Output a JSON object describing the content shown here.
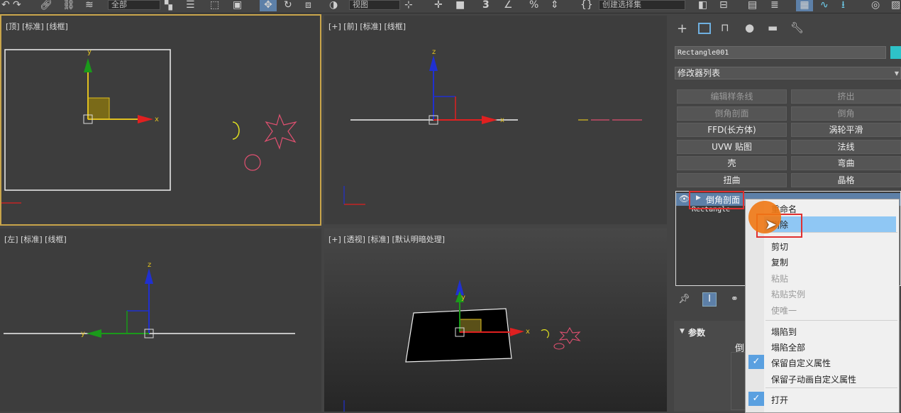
{
  "toolbar": {
    "filter_dropdown": "全部",
    "view_dropdown": "视图",
    "selection_set": "创建选择集",
    "toggle_3": "3",
    "percent": "%"
  },
  "viewports": {
    "top": "[顶] [标准] [线框]",
    "front": "[+] [前] [标准] [线框]",
    "left": "[左] [标准] [线框]",
    "persp": "[+] [透视] [标准] [默认明暗处理]"
  },
  "axis": {
    "x": "x",
    "y": "y",
    "z": "z"
  },
  "panel": {
    "object_name": "Rectangle001",
    "modifier_list": "修改器列表",
    "buttons": [
      {
        "label": "编辑样条线",
        "enabled": false
      },
      {
        "label": "挤出",
        "enabled": false
      },
      {
        "label": "倒角剖面",
        "enabled": false
      },
      {
        "label": "倒角",
        "enabled": false
      },
      {
        "label": "FFD(长方体)",
        "enabled": true
      },
      {
        "label": "涡轮平滑",
        "enabled": true
      },
      {
        "label": "UVW 贴图",
        "enabled": true
      },
      {
        "label": "法线",
        "enabled": true
      },
      {
        "label": "壳",
        "enabled": true
      },
      {
        "label": "弯曲",
        "enabled": true
      },
      {
        "label": "扭曲",
        "enabled": true
      },
      {
        "label": "晶格",
        "enabled": true
      }
    ],
    "stack_modifier": "倒角剖面",
    "stack_base": "Rectangle",
    "params_title": "参数",
    "params_partial": "倒"
  },
  "context_menu": {
    "items": [
      {
        "label": "重命名",
        "enabled": true
      },
      {
        "label": "删除",
        "enabled": true,
        "highlighted": true
      },
      {
        "label": "剪切",
        "enabled": true
      },
      {
        "label": "复制",
        "enabled": true
      },
      {
        "label": "粘贴",
        "enabled": false
      },
      {
        "label": "粘贴实例",
        "enabled": false
      },
      {
        "label": "使唯一",
        "enabled": false
      },
      {
        "label": "塌陷到",
        "enabled": true
      },
      {
        "label": "塌陷全部",
        "enabled": true
      },
      {
        "label": "保留自定义属性",
        "enabled": true,
        "checked": true
      },
      {
        "label": "保留子动画自定义属性",
        "enabled": true
      },
      {
        "label": "打开",
        "enabled": true,
        "checked": true
      }
    ]
  },
  "colors": {
    "highlight": "#8fc7f4",
    "active_border": "#c8a44a",
    "annotation_red": "#e03030",
    "x_axis": "#e02020",
    "y_axis": "#1a9a1a",
    "z_axis": "#2030d0"
  }
}
